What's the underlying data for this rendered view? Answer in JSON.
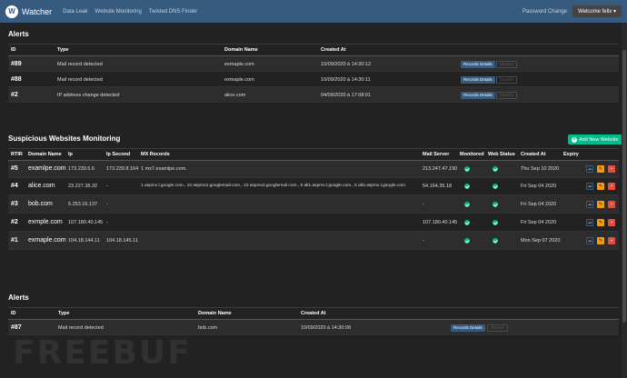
{
  "nav": {
    "brand": "Watcher",
    "links": [
      "Data Leak",
      "Website Monitoring",
      "Twisted DNS Finder"
    ],
    "password_change": "Password Change",
    "user": "Welcome felix"
  },
  "alerts_top": {
    "title": "Alerts",
    "headers": [
      "ID",
      "Type",
      "Domain Name",
      "Created At"
    ],
    "rows": [
      {
        "id": "#89",
        "type": "Mail record detected",
        "domain": "exmaple.com",
        "created": "10/09/2020 à 14:30:12"
      },
      {
        "id": "#88",
        "type": "Mail record detected",
        "domain": "exmaple.com",
        "created": "10/09/2020 à 14:30:11"
      },
      {
        "id": "#2",
        "type": "IP address change detected",
        "domain": "alice.com",
        "created": "04/09/2020 à 17:08:01"
      }
    ],
    "records_label": "Records Details",
    "disable_label": "Disable"
  },
  "monitoring": {
    "title": "Suspicious Websites Monitoring",
    "add_label": "Add New Website",
    "headers": [
      "RTIR",
      "Domain Name",
      "Ip",
      "Ip Second",
      "MX Records",
      "Mail Server",
      "Monitored",
      "Web Status",
      "Created At",
      "Expiry"
    ],
    "rows": [
      {
        "rtir": "#5",
        "domain": "examlpe.com",
        "ip": "173.239.5.6",
        "ip2": "173.239.8.164",
        "mx": "1 mx7.examlpe.com.",
        "mail": "213.247.47.190",
        "created": "Thu Sep 10 2020"
      },
      {
        "rtir": "#4",
        "domain": "alice.com",
        "ip": "23.227.38.32",
        "ip2": "-",
        "mx": "1 aspmx.l.google.com., 10 aspmx2.googlemail.com., 10 aspmx3.googlemail.com., 5 alt1.aspmx.l.google.com., 5 alt2.aspmx.l.google.com.",
        "mail": "54.164.35.18",
        "created": "Fri Sep 04 2020"
      },
      {
        "rtir": "#3",
        "domain": "bob.com",
        "ip": "5.253.16.137",
        "ip2": "-",
        "mx": "",
        "mail": "-",
        "created": "Fri Sep 04 2020"
      },
      {
        "rtir": "#2",
        "domain": "exmple.com",
        "ip": "107.180.40.145",
        "ip2": "-",
        "mx": "",
        "mail": "107.180.40.145",
        "created": "Fri Sep 04 2020"
      },
      {
        "rtir": "#1",
        "domain": "exmaple.com",
        "ip": "104.18.144.11",
        "ip2": "104.18.145.11",
        "mx": "",
        "mail": "-",
        "created": "Mon Sep 07 2020"
      }
    ]
  },
  "alerts_bottom": {
    "title": "Alerts",
    "headers": [
      "ID",
      "Type",
      "Domain Name",
      "Created At"
    ],
    "rows": [
      {
        "id": "#87",
        "type": "Mail record detected",
        "domain": "bob.com",
        "created": "10/09/2020 à 14:30:08"
      }
    ],
    "records_label": "Records Details",
    "disable_label": "Disable"
  },
  "watermark": "FREEBUF",
  "colors": {
    "primary": "#375a7f",
    "success": "#00bc8c",
    "warning": "#f39c12",
    "danger": "#e74c3c"
  }
}
